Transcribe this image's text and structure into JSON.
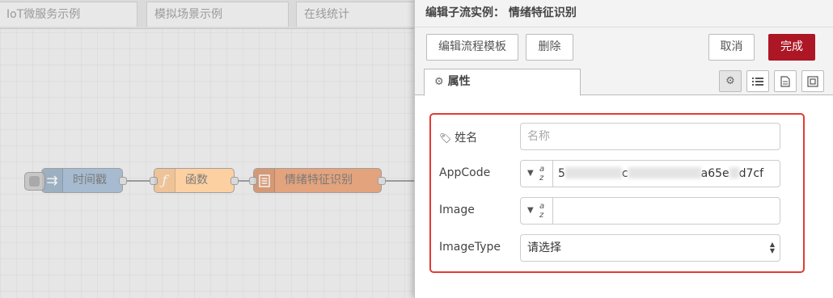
{
  "workspace": {
    "tabs": [
      "IoT微服务示例",
      "模拟场景示例",
      "在线统计"
    ],
    "nodes": [
      {
        "label": "时间戳",
        "icon": "arrows-icon",
        "color": "#a6bbcf"
      },
      {
        "label": "函数",
        "icon": "function-icon",
        "color": "#fdd0a2"
      },
      {
        "label": "情绪特征识别",
        "icon": "subflow-icon",
        "color": "#e2a37d"
      }
    ]
  },
  "tray": {
    "title": "编辑子流实例： 情绪特征识别",
    "toolbar": {
      "edit_template": "编辑流程模板",
      "delete": "删除",
      "cancel": "取消",
      "done": "完成"
    },
    "tabs": {
      "properties": "属性"
    },
    "form": {
      "name": {
        "label": "姓名",
        "placeholder": "名称"
      },
      "appcode": {
        "label": "AppCode",
        "value_visible_suffix": "a65e",
        "value_tail": "d7cf",
        "value_fragment": "5",
        "value_fragment2": "c"
      },
      "image": {
        "label": "Image",
        "value": ""
      },
      "image_type": {
        "label": "ImageType",
        "selected": "请选择"
      }
    }
  },
  "colors": {
    "accent": "#ad1625",
    "highlight": "#e23b33"
  }
}
